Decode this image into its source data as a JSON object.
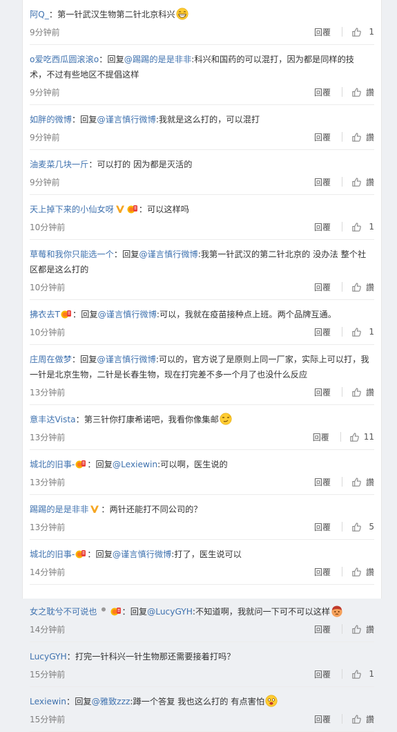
{
  "ui": {
    "reply_label": "回覆",
    "like_zan_label": "讚"
  },
  "comments": [
    {
      "user": "阿Q_",
      "sep": "：",
      "text": "第一针武汉生物第二针北京科兴",
      "time": "9分钟前",
      "likes": "1",
      "emoji": "grin"
    },
    {
      "user": "o爱吃西瓜圆滚滚o",
      "sep": "：",
      "reply_prefix": "回复",
      "mention": "@踢踢的是是非非",
      "text": ":科兴和国药的可以混打，因为都是同样的技术，不过有些地区不提倡这样",
      "time": "9分钟前",
      "likes": "讚"
    },
    {
      "user": "如胖的微博",
      "sep": "：",
      "reply_prefix": "回复",
      "mention": "@谨言慎行微博",
      "text": ":我就是这么打的，可以混打",
      "time": "9分钟前",
      "likes": "讚"
    },
    {
      "user": "油麦菜几块一斤",
      "sep": "：",
      "text": "可以打的 因为都是灭活的",
      "time": "9分钟前",
      "likes": "讚"
    },
    {
      "user": "天上掉下来的小仙女呀",
      "badges": [
        "v",
        "medal"
      ],
      "sep": "：",
      "text": "可以这样吗",
      "time": "10分钟前",
      "likes": "1"
    },
    {
      "user": "草莓和我你只能选一个",
      "sep": "：",
      "reply_prefix": "回复",
      "mention": "@谨言慎行微博",
      "text": ":我第一针武汉的第二针北京的 没办法 整个社区都是这么打的",
      "time": "10分钟前",
      "likes": "讚"
    },
    {
      "user": "拂衣去T",
      "badges": [
        "medal"
      ],
      "sep": "：",
      "reply_prefix": "回复",
      "mention": "@谨言慎行微博",
      "text": ":可以，我就在疫苗接种点上班。两个品牌互通。",
      "time": "10分钟前",
      "likes": "1"
    },
    {
      "user": "庄周在做梦",
      "sep": "：",
      "reply_prefix": "回复",
      "mention": "@谨言慎行微博",
      "text": ":可以的，官方说了是原则上同一厂家，实际上可以打，我一针是北京生物，二针是长春生物，现在打完差不多一个月了也没什么反应",
      "time": "13分钟前",
      "likes": "讚"
    },
    {
      "user": "意丰达Vista",
      "sep": "：",
      "text": "第三针你打康希诺吧，我看你像集邮",
      "time": "13分钟前",
      "likes": "11",
      "emoji": "smirk"
    },
    {
      "user": "城北的旧事-",
      "badges": [
        "medal"
      ],
      "sep": "：",
      "reply_prefix": "回复",
      "mention": "@Lexiewin",
      "text": ":可以啊，医生说的",
      "time": "13分钟前",
      "likes": "讚"
    },
    {
      "user": "踢踢的是是非非",
      "badges": [
        "v"
      ],
      "sep": "：",
      "text": "两针还能打不同公司的？",
      "time": "13分钟前",
      "likes": "5"
    },
    {
      "user": "城北的旧事-",
      "badges": [
        "medal"
      ],
      "sep": "：",
      "reply_prefix": "回复",
      "mention": "@谨言慎行微博",
      "text": ":打了，医生说可以",
      "time": "14分钟前",
      "likes": "讚"
    },
    {
      "user": "女之耽兮不可说也",
      "badges": [
        "dot",
        "medal"
      ],
      "sep": "：",
      "reply_prefix": "回复",
      "mention": "@LucyGYH",
      "text": ":不知道啊，我就问一下可不可以这样",
      "time": "14分钟前",
      "likes": "讚",
      "emoji": "cry"
    },
    {
      "user": "LucyGYH",
      "sep": "：",
      "text": "打完一针科兴一针生物那还需要接着打吗？",
      "time": "15分钟前",
      "likes": "1"
    },
    {
      "user": "Lexiewin",
      "sep": "：",
      "reply_prefix": "回复",
      "mention": "@雅致zzz",
      "text": ":蹲一个答复 我也这么打的 有点害怕",
      "time": "15分钟前",
      "likes": "讚",
      "emoji": "scared"
    }
  ]
}
